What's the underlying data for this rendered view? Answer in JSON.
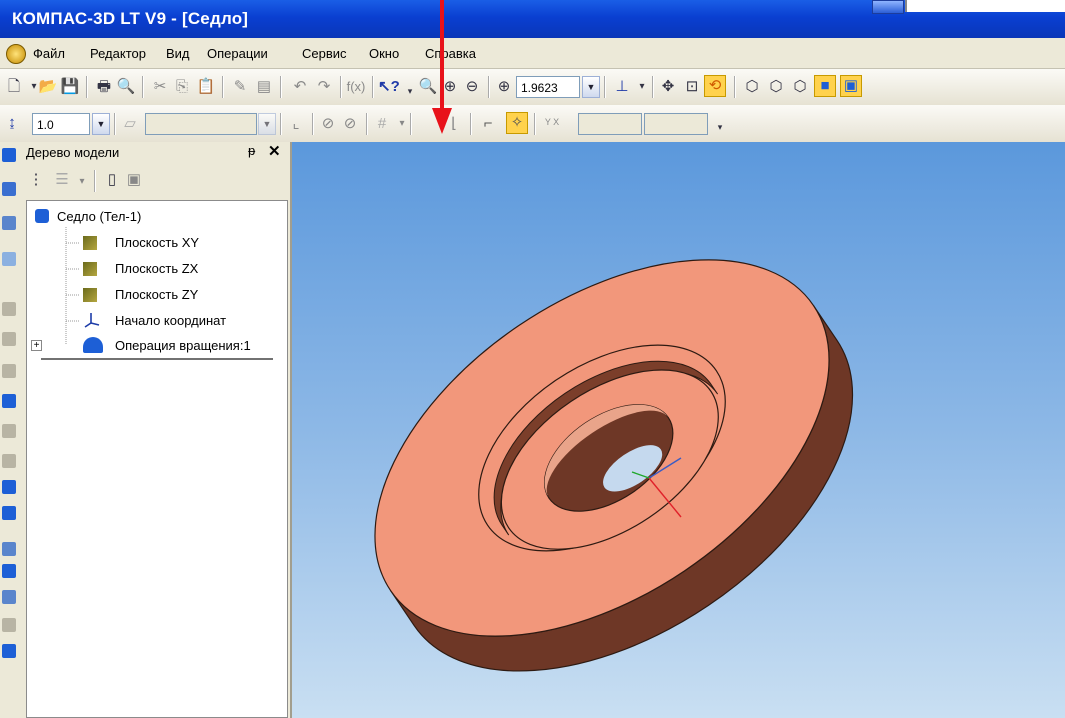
{
  "window": {
    "title": "КОМПАС-3D LT V9 - [Седло]"
  },
  "menu": {
    "items": [
      {
        "key": "file",
        "label": "Файл"
      },
      {
        "key": "edit",
        "label": "Редактор"
      },
      {
        "key": "view",
        "label": "Вид"
      },
      {
        "key": "operations",
        "label": "Операции"
      },
      {
        "key": "service",
        "label": "Сервис"
      },
      {
        "key": "window",
        "label": "Окно"
      },
      {
        "key": "help",
        "label": "Справка"
      }
    ]
  },
  "toolbar1": {
    "zoom_value": "1.9623"
  },
  "toolbar2": {
    "step_value": "1.0",
    "coord_label": "Y X"
  },
  "tree_panel": {
    "title": "Дерево модели",
    "pin_glyph": "ᵽ",
    "close_glyph": "✕",
    "root": "Седло (Тел-1)",
    "items": [
      {
        "label": "Плоскость XY",
        "icon": "plane-icon"
      },
      {
        "label": "Плоскость ZX",
        "icon": "plane-icon"
      },
      {
        "label": "Плоскость ZY",
        "icon": "plane-icon"
      },
      {
        "label": "Начало координат",
        "icon": "origin-axes-icon"
      },
      {
        "label": "Операция вращения:1",
        "icon": "revolve-operation-icon",
        "expand": "+"
      }
    ]
  },
  "model": {
    "name": "Седло",
    "face_color": "#f2977b",
    "side_color": "#6e3726",
    "accent_arrow_color": "#e8121a"
  }
}
